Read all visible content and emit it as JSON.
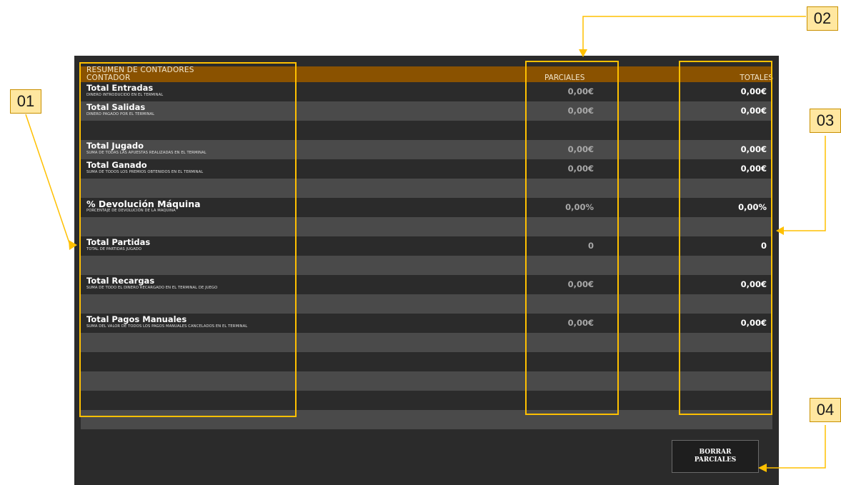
{
  "panel": {
    "title_line1": "RESUMEN DE CONTADORES",
    "title_line2": "CONTADOR",
    "col_partial": "PARCIALES",
    "col_total": "TOTALES"
  },
  "counters": [
    {
      "label": "Total Entradas",
      "desc": "DINERO INTRODUCIDO EN EL TERMINAL",
      "partial": "0,00€",
      "total": "0,00€"
    },
    {
      "label": "Total Salidas",
      "desc": "DINERO PAGADO POR EL TERMINAL",
      "partial": "0,00€",
      "total": "0,00€"
    },
    {
      "label": "Total Jugado",
      "desc": "SUMA DE TODAS LAS APUESTAS REALIZADAS EN EL TERMINAL",
      "partial": "0,00€",
      "total": "0,00€"
    },
    {
      "label": "Total Ganado",
      "desc": "SUMA DE TODOS LOS PREMIOS OBTENIDOS EN EL TERMINAL",
      "partial": "0,00€",
      "total": "0,00€"
    },
    {
      "label": "% Devolución Máquina",
      "desc": "PORCENTAJE DE DEVOLUCIÓN DE LA MAQUINA",
      "partial": "0,00%",
      "total": "0,00%"
    },
    {
      "label": "Total Partidas",
      "desc": "TOTAL DE PARTIDAS JUGADO",
      "partial": "0",
      "total": "0"
    },
    {
      "label": "Total Recargas",
      "desc": "SUMA DE TODO EL DINERO RECARGADO EN EL TERMINAL DE JUEGO",
      "partial": "0,00€",
      "total": "0,00€"
    },
    {
      "label": "Total Pagos Manuales",
      "desc": "SUMA DEL VALOR DE TODOS LOS PAGOS MANUALES CANCELADOS EN EL TERMINAL",
      "partial": "0,00€",
      "total": "0,00€"
    }
  ],
  "reset_button": {
    "line1": "BORRAR",
    "line2": "PARCIALES"
  },
  "callouts": {
    "c1": "01",
    "c2": "02",
    "c3": "03",
    "c4": "04"
  },
  "colors": {
    "header_band": "#8a5200",
    "highlight": "#ffc000",
    "callout_fill": "#ffe7a0"
  }
}
